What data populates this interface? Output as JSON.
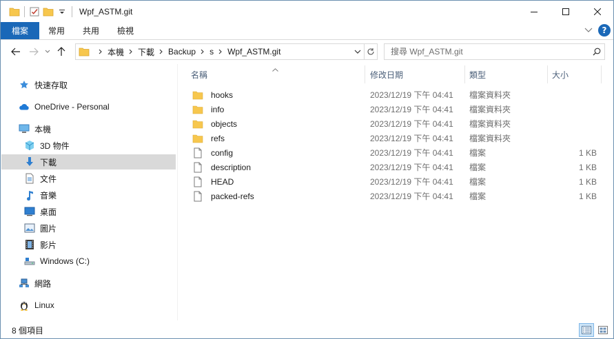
{
  "window": {
    "title": "Wpf_ASTM.git"
  },
  "ribbon": {
    "tabs": [
      {
        "label": "檔案"
      },
      {
        "label": "常用"
      },
      {
        "label": "共用"
      },
      {
        "label": "檢視"
      }
    ]
  },
  "address": {
    "crumbs": [
      "本機",
      "下載",
      "Backup",
      "s",
      "Wpf_ASTM.git"
    ]
  },
  "search": {
    "placeholder": "搜尋 Wpf_ASTM.git"
  },
  "nav_pane": {
    "items": [
      {
        "label": "快速存取",
        "icon": "star-icon",
        "selected": false
      },
      {
        "label": "OneDrive - Personal",
        "icon": "cloud-icon",
        "selected": false
      },
      {
        "label": "本機",
        "icon": "computer-icon",
        "selected": false
      },
      {
        "label": "3D 物件",
        "icon": "cube-icon",
        "selected": false
      },
      {
        "label": "下載",
        "icon": "download-arrow-icon",
        "selected": true
      },
      {
        "label": "文件",
        "icon": "document-icon",
        "selected": false
      },
      {
        "label": "音樂",
        "icon": "music-note-icon",
        "selected": false
      },
      {
        "label": "桌面",
        "icon": "desktop-icon",
        "selected": false
      },
      {
        "label": "圖片",
        "icon": "picture-icon",
        "selected": false
      },
      {
        "label": "影片",
        "icon": "film-icon",
        "selected": false
      },
      {
        "label": "Windows (C:)",
        "icon": "drive-icon",
        "selected": false
      },
      {
        "label": "網路",
        "icon": "network-icon",
        "selected": false
      },
      {
        "label": "Linux",
        "icon": "linux-penguin-icon",
        "selected": false
      }
    ]
  },
  "file_list": {
    "columns": [
      "名稱",
      "修改日期",
      "類型",
      "大小"
    ],
    "rows": [
      {
        "name": "hooks",
        "date": "2023/12/19 下午 04:41",
        "type": "檔案資料夾",
        "size": "",
        "kind": "folder"
      },
      {
        "name": "info",
        "date": "2023/12/19 下午 04:41",
        "type": "檔案資料夾",
        "size": "",
        "kind": "folder"
      },
      {
        "name": "objects",
        "date": "2023/12/19 下午 04:41",
        "type": "檔案資料夾",
        "size": "",
        "kind": "folder"
      },
      {
        "name": "refs",
        "date": "2023/12/19 下午 04:41",
        "type": "檔案資料夾",
        "size": "",
        "kind": "folder"
      },
      {
        "name": "config",
        "date": "2023/12/19 下午 04:41",
        "type": "檔案",
        "size": "1 KB",
        "kind": "file"
      },
      {
        "name": "description",
        "date": "2023/12/19 下午 04:41",
        "type": "檔案",
        "size": "1 KB",
        "kind": "file"
      },
      {
        "name": "HEAD",
        "date": "2023/12/19 下午 04:41",
        "type": "檔案",
        "size": "1 KB",
        "kind": "file"
      },
      {
        "name": "packed-refs",
        "date": "2023/12/19 下午 04:41",
        "type": "檔案",
        "size": "1 KB",
        "kind": "file"
      }
    ]
  },
  "status": {
    "item_count": "8 個項目"
  },
  "colors": {
    "accent": "#1a68b8",
    "folder": "#f7c74e",
    "selected_bg": "#d9d9d9"
  }
}
